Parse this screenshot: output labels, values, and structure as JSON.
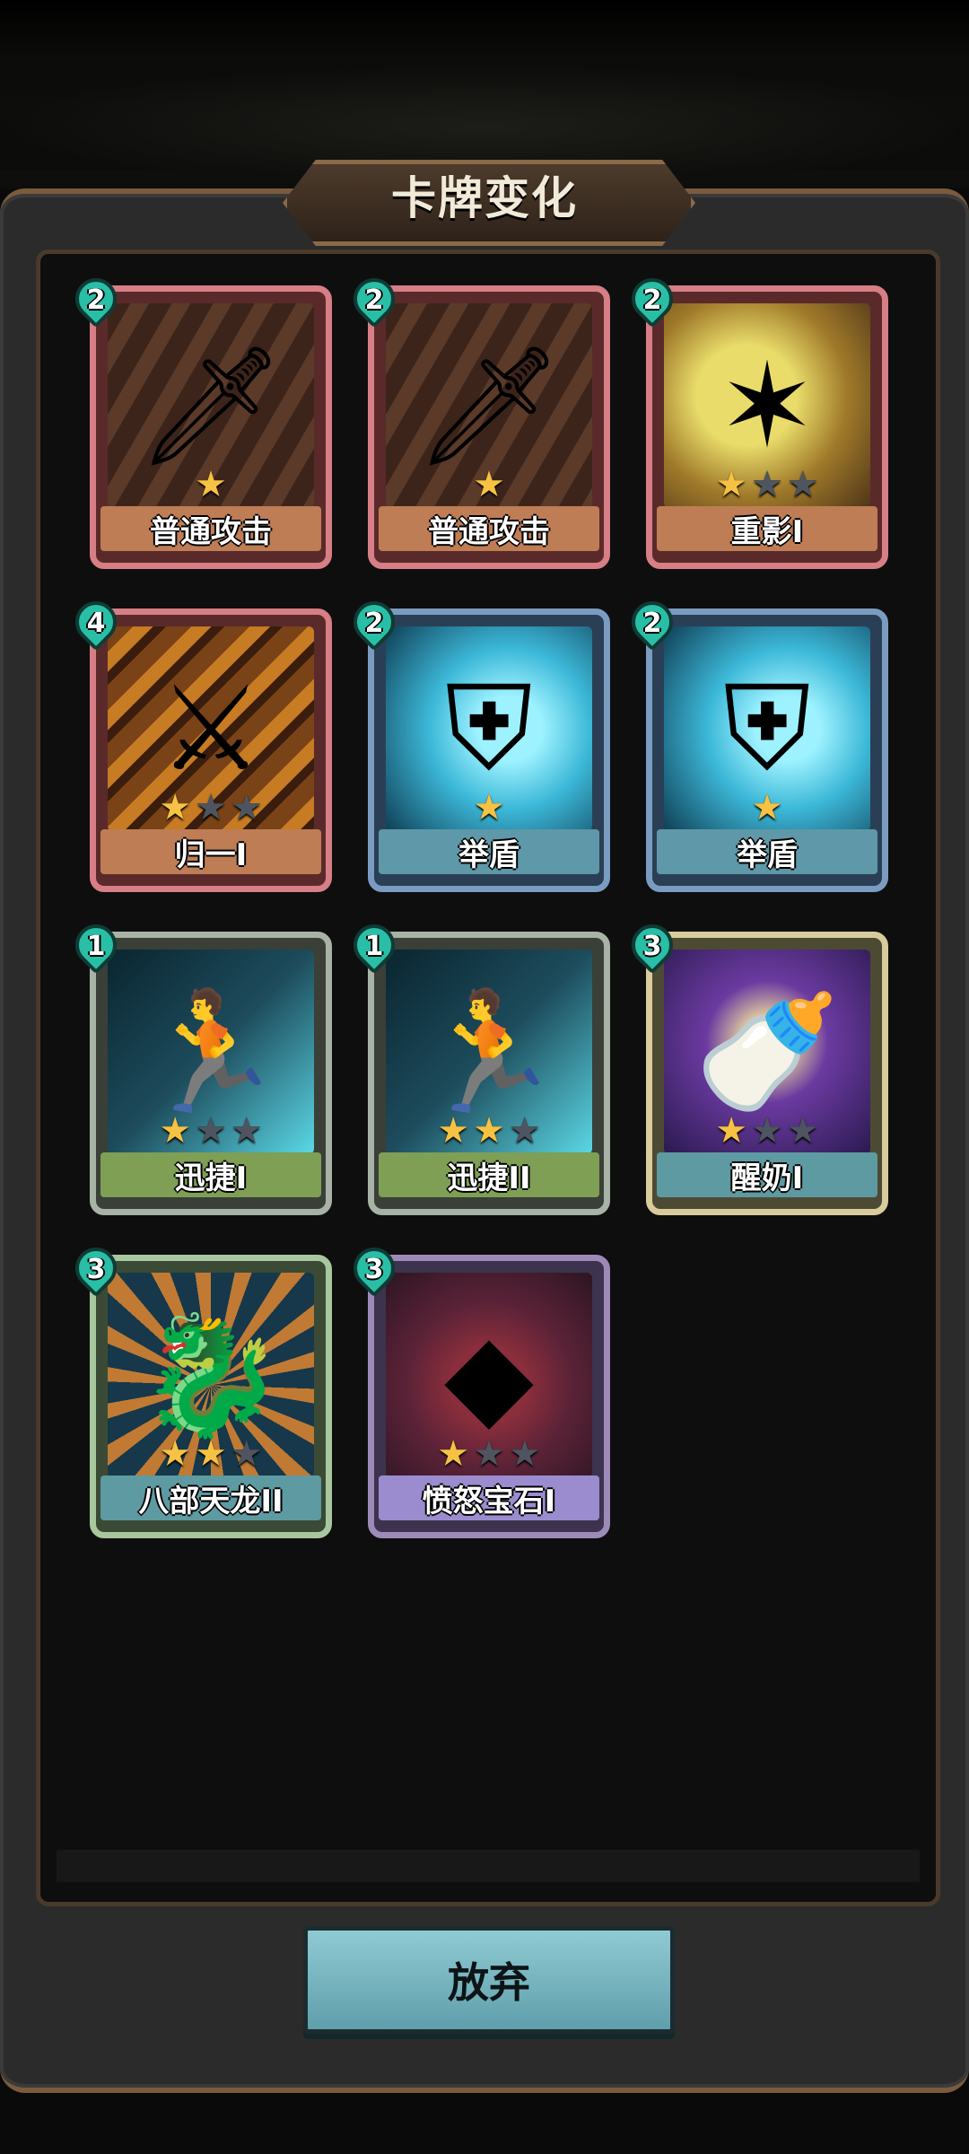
{
  "title": "卡牌变化",
  "cards": [
    {
      "name": "普通攻击",
      "cost": "2",
      "stars": 1,
      "max_stars": 1,
      "rarity": "red",
      "art": "sword-icon"
    },
    {
      "name": "普通攻击",
      "cost": "2",
      "stars": 1,
      "max_stars": 1,
      "rarity": "red",
      "art": "sword-icon"
    },
    {
      "name": "重影I",
      "cost": "2",
      "stars": 1,
      "max_stars": 3,
      "rarity": "red",
      "art": "claw-icon"
    },
    {
      "name": "归一I",
      "cost": "4",
      "stars": 1,
      "max_stars": 3,
      "rarity": "red",
      "art": "blade-icon"
    },
    {
      "name": "举盾",
      "cost": "2",
      "stars": 1,
      "max_stars": 1,
      "rarity": "blue",
      "art": "shield-knight-icon"
    },
    {
      "name": "举盾",
      "cost": "2",
      "stars": 1,
      "max_stars": 1,
      "rarity": "blue",
      "art": "shield-knight-icon"
    },
    {
      "name": "迅捷I",
      "cost": "1",
      "stars": 1,
      "max_stars": 3,
      "rarity": "green",
      "art": "runner-icon"
    },
    {
      "name": "迅捷II",
      "cost": "1",
      "stars": 2,
      "max_stars": 3,
      "rarity": "green",
      "art": "runner-icon"
    },
    {
      "name": "醒奶I",
      "cost": "3",
      "stars": 1,
      "max_stars": 3,
      "rarity": "gold",
      "art": "milk-bottle-icon"
    },
    {
      "name": "八部天龙II",
      "cost": "3",
      "stars": 2,
      "max_stars": 3,
      "rarity": "teal",
      "art": "dragon-icon"
    },
    {
      "name": "愤怒宝石I",
      "cost": "3",
      "stars": 1,
      "max_stars": 3,
      "rarity": "purple",
      "art": "gem-icon"
    }
  ],
  "abandon_label": "放弃",
  "colors": {
    "cost_drop": "#28bfa6",
    "star_on": "#f6c243",
    "star_off": "#4f5560"
  }
}
